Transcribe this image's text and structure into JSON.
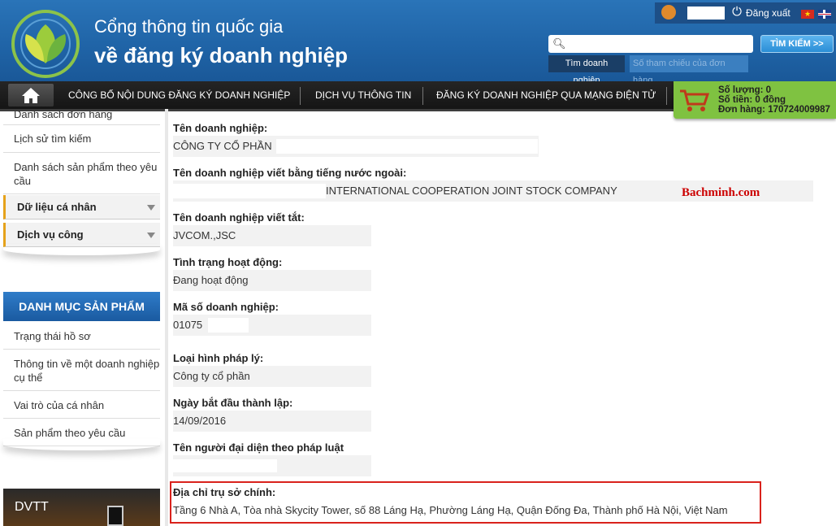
{
  "header": {
    "title_line1": "Cổng thông tin quốc gia",
    "title_line2": "về đăng ký doanh nghiệp",
    "logout": "Đăng xuất",
    "flag_vn_glyph": "★"
  },
  "search": {
    "placeholder": "",
    "button": "TÌM KIẾM >>",
    "tab_active": "Tìm doanh nghiệp",
    "tab_inactive": "Số tham chiếu của đơn hàng"
  },
  "nav": {
    "items": [
      "CÔNG BỐ NỘI DUNG ĐĂNG KÝ DOANH NGHIỆP",
      "DỊCH VỤ THÔNG TIN",
      "ĐĂNG KÝ DOANH NGHIỆP QUA MẠNG ĐIỆN TỬ"
    ]
  },
  "cart": {
    "quantity": "Số lượng: 0",
    "amount": "Số tiền: 0 đồng",
    "order": "Đơn hàng: 170724009987"
  },
  "sidebar": {
    "links_top": [
      "Danh sách đơn hàng",
      "Lịch sử tìm kiếm",
      "Danh sách sản phẩm theo yêu cầu"
    ],
    "categories": [
      "Dữ liệu cá nhân",
      "Dịch vụ công"
    ],
    "catalog_header": "DANH MỤC SẢN PHẨM",
    "catalog_links": [
      "Trạng thái hồ sơ",
      "Thông tin về một doanh nghiệp cụ thể",
      "Vai trò của cá nhân",
      "Sản phẩm theo yêu cầu"
    ],
    "banner": "DVTT"
  },
  "company": {
    "name_label": "Tên doanh nghiệp:",
    "name_value": "CÔNG TY CỔ PHẦN",
    "foreign_name_label": "Tên doanh nghiệp viết bằng tiếng nước ngoài:",
    "foreign_name_value": "INTERNATIONAL COOPERATION JOINT STOCK COMPANY",
    "short_name_label": "Tên doanh nghiệp viết tắt:",
    "short_name_value": "JVCOM.,JSC",
    "status_label": "Tình trạng hoạt động:",
    "status_value": "Đang hoạt động",
    "tax_code_label": "Mã số doanh nghiệp:",
    "tax_code_value": "01075",
    "legal_type_label": "Loại hình pháp lý:",
    "legal_type_value": "Công ty cổ phần",
    "founded_label": "Ngày bắt đầu thành lập:",
    "founded_value": "14/09/2016",
    "representative_label": "Tên người đại diện theo pháp luật",
    "address_label": "Địa chỉ trụ sở chính:",
    "address_value": "Tầng 6 Nhà A, Tòa nhà Skycity Tower, số 88 Láng Hạ, Phường Láng Hạ, Quận Đống Đa, Thành phố Hà Nội, Việt Nam"
  },
  "watermark": "Bachminh.com",
  "colors": {
    "header_blue": "#1f63a6",
    "nav_dark": "#1b1b1b",
    "cart_green": "#7fc241",
    "accent_orange": "#e5a21b",
    "highlight_red": "#d9221c",
    "watermark_red": "#cc0000"
  }
}
